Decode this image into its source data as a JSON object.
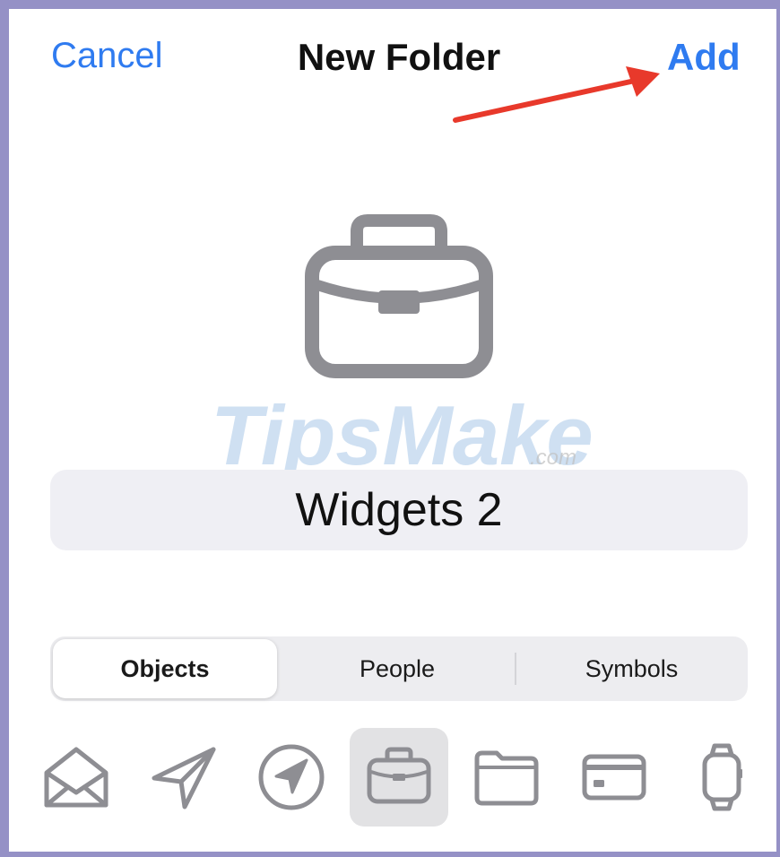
{
  "nav": {
    "cancel_label": "Cancel",
    "title": "New Folder",
    "add_label": "Add"
  },
  "preview": {
    "icon": "briefcase-icon"
  },
  "watermark": {
    "text_main": "TipsMake",
    "text_suffix": ".com"
  },
  "name_field": {
    "value": "Widgets 2"
  },
  "segmented": {
    "selected_index": 0,
    "items": [
      {
        "label": "Objects"
      },
      {
        "label": "People"
      },
      {
        "label": "Symbols"
      }
    ]
  },
  "icon_picker": {
    "selected_index": 3,
    "icons": [
      "open-envelope-icon",
      "paper-plane-icon",
      "location-arrow-circle-icon",
      "briefcase-icon",
      "folder-icon",
      "credit-card-icon",
      "watch-icon"
    ]
  },
  "colors": {
    "accent": "#2f7bf0",
    "icon_gray": "#8e8e93",
    "arrow_red": "#e8392b",
    "frame_border": "#9591c6",
    "field_bg": "#efeff4"
  }
}
